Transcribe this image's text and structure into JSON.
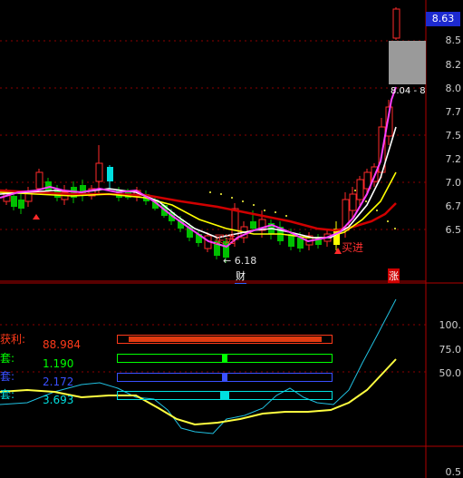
{
  "price_axis": {
    "labels": [
      "8.5",
      "8.2",
      "8.0",
      "7.7",
      "7.5",
      "7.2",
      "7.0",
      "6.7",
      "6.5"
    ],
    "current_price": "8.63",
    "range_label": "8.04 - 8"
  },
  "indicator_axis": {
    "labels": [
      "100.",
      "75.0",
      "50.0",
      "0.5"
    ]
  },
  "annotations": {
    "buy_label_1": "买进",
    "buy_label_2": "买进",
    "low_price": "← 6.18",
    "event_tag_1": "财",
    "event_tag_2": "涨"
  },
  "panel": {
    "rows": [
      {
        "label": "获利:",
        "value": "88.984",
        "color": "#ff3a1a",
        "fill_percent": 96
      },
      {
        "label": "套:",
        "value": "1.190",
        "color": "#00ff00",
        "fill_percent": 50
      },
      {
        "label": "套:",
        "value": "2.172",
        "color": "#3a50ff",
        "fill_percent": 50
      },
      {
        "label": "套:",
        "value": "3.693",
        "color": "#00e0e0",
        "fill_percent": 50
      }
    ]
  },
  "colors": {
    "up": "#ff2a2a",
    "down": "#00e0e0",
    "grid": "#8b0000",
    "ma_white": "#ffffff",
    "ma_yellow": "#ffff00",
    "ma_magenta": "#ff40ff",
    "ma_red": "#d00000",
    "ind_cyan": "#20c0e0",
    "ind_yellow": "#ffff40"
  }
}
